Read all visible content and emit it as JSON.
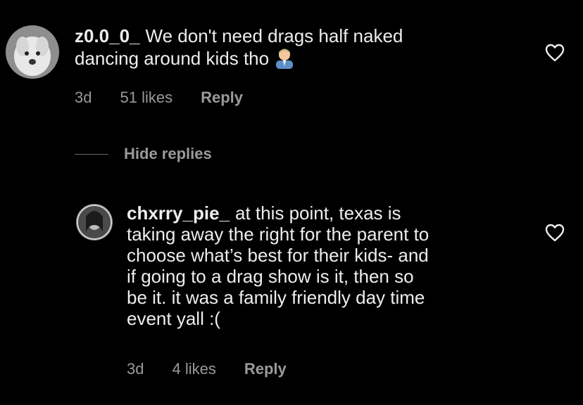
{
  "comments": [
    {
      "username": "z0.0_0_",
      "text_line1": "We don't need drags half naked",
      "text_line2": "dancing around kids tho",
      "emoji_icon": "man-office-worker-emoji",
      "age": "3d",
      "likes": "51 likes",
      "reply_label": "Reply"
    }
  ],
  "hide_replies_label": "Hide replies",
  "replies": [
    {
      "username": "chxrry_pie_",
      "lines": [
        "at this point, texas is",
        "taking away the right for the parent to",
        "choose what’s best for their kids- and",
        "if going to a drag show is it, then so",
        "be it. it was a family friendly day time",
        "event yall :("
      ],
      "age": "3d",
      "likes": "4 likes",
      "reply_label": "Reply"
    }
  ],
  "icons": {
    "like": "heart-outline-icon"
  },
  "colors": {
    "background": "#000000",
    "text": "#ededed",
    "meta": "#9a9a9a"
  }
}
